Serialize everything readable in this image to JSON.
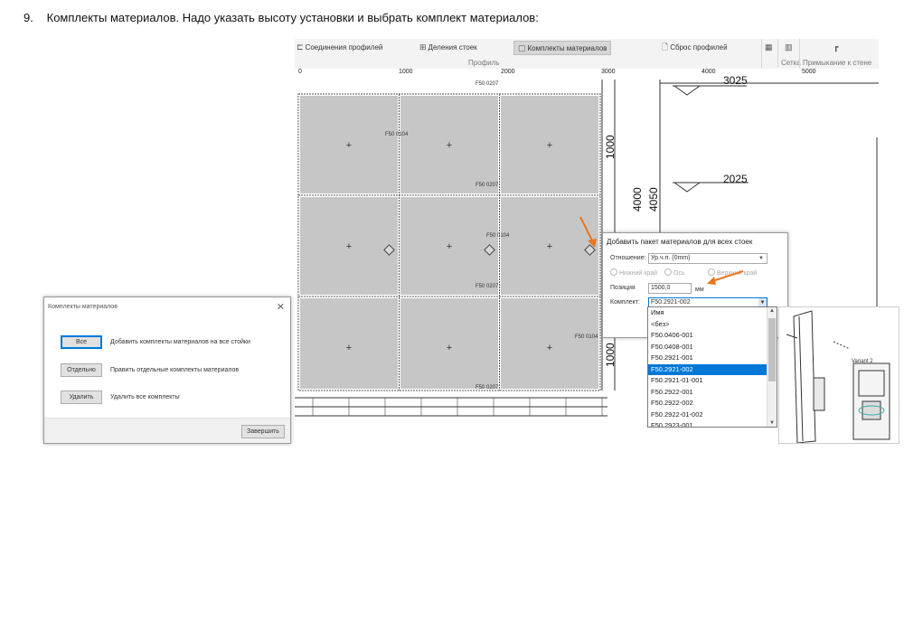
{
  "instruction": {
    "number": "9.",
    "text": "Комплекты материалов. Надо указать высоту установки и выбрать комплект материалов:"
  },
  "ribbon": {
    "items": [
      {
        "label": "Соединения профилей",
        "icon": "profile-joint-icon"
      },
      {
        "label": "Деления стоек",
        "icon": "post-division-icon"
      },
      {
        "label": "Комплекты материалов",
        "icon": "material-kit-icon"
      },
      {
        "label": "Сброс профилей",
        "icon": "reset-profiles-icon"
      }
    ],
    "group_profile": "Профиль",
    "group_grid": "Сетка",
    "group_wall": "Примыкание к стене"
  },
  "ruler": {
    "marks": [
      "0",
      "1000",
      "2000",
      "3000",
      "4000",
      "5000"
    ]
  },
  "drawing": {
    "profile_labels": [
      "F50 0207",
      "F50 0104",
      "F50 0207",
      "F50 0104",
      "F50 0207",
      "F50 0104",
      "F50 0207"
    ],
    "dims_vertical": [
      "1000",
      "4000",
      "4050",
      "1000"
    ],
    "dims_horizontal": [
      "3025",
      "2025"
    ]
  },
  "kits_dialog": {
    "title": "Комплекты материалов",
    "buttons": [
      {
        "label": "Все",
        "description": "Добавить комплекты материалов на все стойки"
      },
      {
        "label": "Отдельно",
        "description": "Править отдельные комплекты материалов"
      },
      {
        "label": "Удалить",
        "description": "Удалить все комплекты"
      }
    ],
    "finish_label": "Завершить"
  },
  "add_dialog": {
    "title": "Добавить пакет материалов для всех стоек",
    "relation_label": "Отношение:",
    "relation_value": "Ур.ч.п. (0mm)",
    "radio_bottom": "Нижний край",
    "radio_axis": "Ось",
    "radio_top": "Верхний край",
    "position_label": "Позиция",
    "position_value": "1500,0",
    "position_unit": "мм",
    "kit_label": "Комплект:",
    "kit_value": "F50.2921-002"
  },
  "kit_list": {
    "header": "Имя",
    "items": [
      "<без>",
      "F50.0406-001",
      "F50.0408-001",
      "F50.2921-001",
      "F50.2921-002",
      "F50.2921-01-001",
      "F50.2922-001",
      "F50.2922-002",
      "F50.2922-01-002",
      "F50.2923-001"
    ],
    "selected_index": 4
  },
  "profile_image": {
    "caption": "Variant 2"
  },
  "colors": {
    "accent": "#0078d7",
    "arrow": "#e8761c",
    "glass": "#c6c6c6"
  }
}
